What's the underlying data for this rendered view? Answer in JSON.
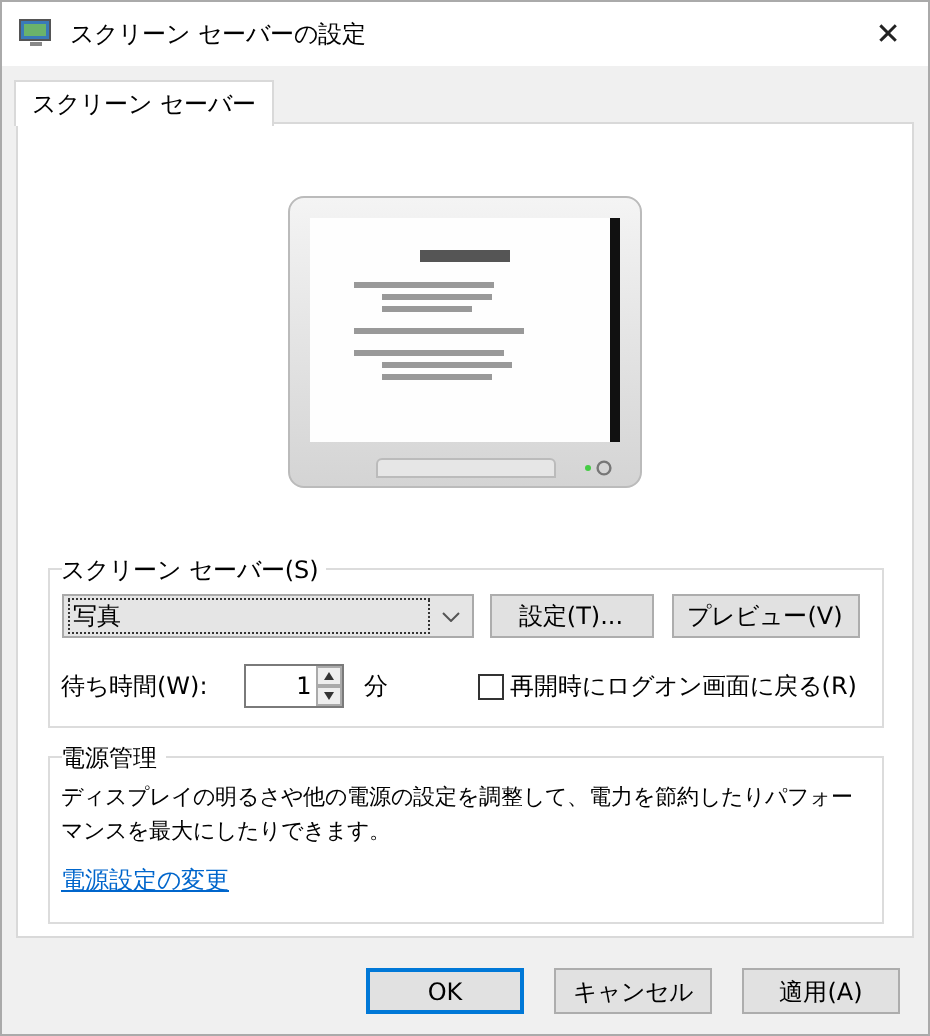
{
  "window": {
    "title": "スクリーン セーバーの設定",
    "close": "✕"
  },
  "tabs": [
    {
      "label": "スクリーン セーバー",
      "selected": true
    }
  ],
  "screen_saver": {
    "group_title": "スクリーン セーバー(S)",
    "selected_value": "写真",
    "settings_button": "設定(T)...",
    "preview_button": "プレビュー(V)",
    "wait_label": "待ち時間(W):",
    "wait_value": "1",
    "wait_unit": "分",
    "logon_label": "再開時にログオン画面に戻る(R)",
    "logon_checked": false
  },
  "power": {
    "group_title": "電源管理",
    "description": "ディスプレイの明るさや他の電源の設定を調整して、電力を節約したりパフォーマンスを最大にしたりできます。",
    "link": "電源設定の変更"
  },
  "buttons": [
    {
      "label": "OK",
      "default": true
    },
    {
      "label": "キャンセル",
      "default": false
    },
    {
      "label": "適用(A)",
      "default": false
    }
  ]
}
